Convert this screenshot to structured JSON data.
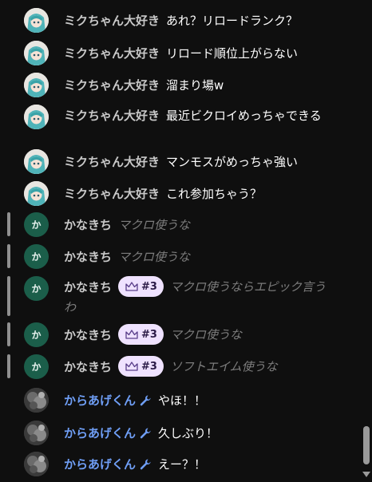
{
  "messages": [
    {
      "author": "ミクちゃん大好き",
      "text": "あれ？リロードランク？"
    },
    {
      "author": "ミクちゃん大好き",
      "text": "リロード順位上がらない"
    },
    {
      "author": "ミクちゃん大好き",
      "text": "溜まり場w"
    },
    {
      "author": "ミクちゃん大好き",
      "text": "最近ビクロイめっちゃできる"
    },
    {
      "author": "ミクちゃん大好き",
      "text": "マンモスがめっちゃ強い"
    },
    {
      "author": "ミクちゃん大好き",
      "text": "これ参加ちゃう？"
    },
    {
      "author": "かなきち",
      "avatar_letter": "か",
      "text": "マクロ使うな"
    },
    {
      "author": "かなきち",
      "avatar_letter": "か",
      "text": "マクロ使うな"
    },
    {
      "author": "かなきち",
      "avatar_letter": "か",
      "badge": "#3",
      "text": "マクロ使うならエピック言うわ"
    },
    {
      "author": "かなきち",
      "avatar_letter": "か",
      "badge": "#3",
      "text": "マクロ使うな"
    },
    {
      "author": "かなきち",
      "avatar_letter": "か",
      "badge": "#3",
      "text": "ソフトエイム使うな"
    },
    {
      "author": "からあげくん",
      "text": "やほ！！"
    },
    {
      "author": "からあげくん",
      "text": "久しぶり！"
    },
    {
      "author": "からあげくん",
      "text": "えー？！"
    }
  ],
  "colors": {
    "background": "#0f0f0f",
    "author": "#c8c8c8",
    "moderator_author": "#6f9ef5",
    "highlight_text": "#7d7d7d",
    "badge_bg": "#efe2ff",
    "stripe": "#909090",
    "kana_avatar": "#1b5e4a"
  },
  "icons": {
    "badge": "crown-icon",
    "moderator": "wrench-icon",
    "miku_avatar": "miku-avatar",
    "karaage_avatar": "karaage-avatar"
  }
}
